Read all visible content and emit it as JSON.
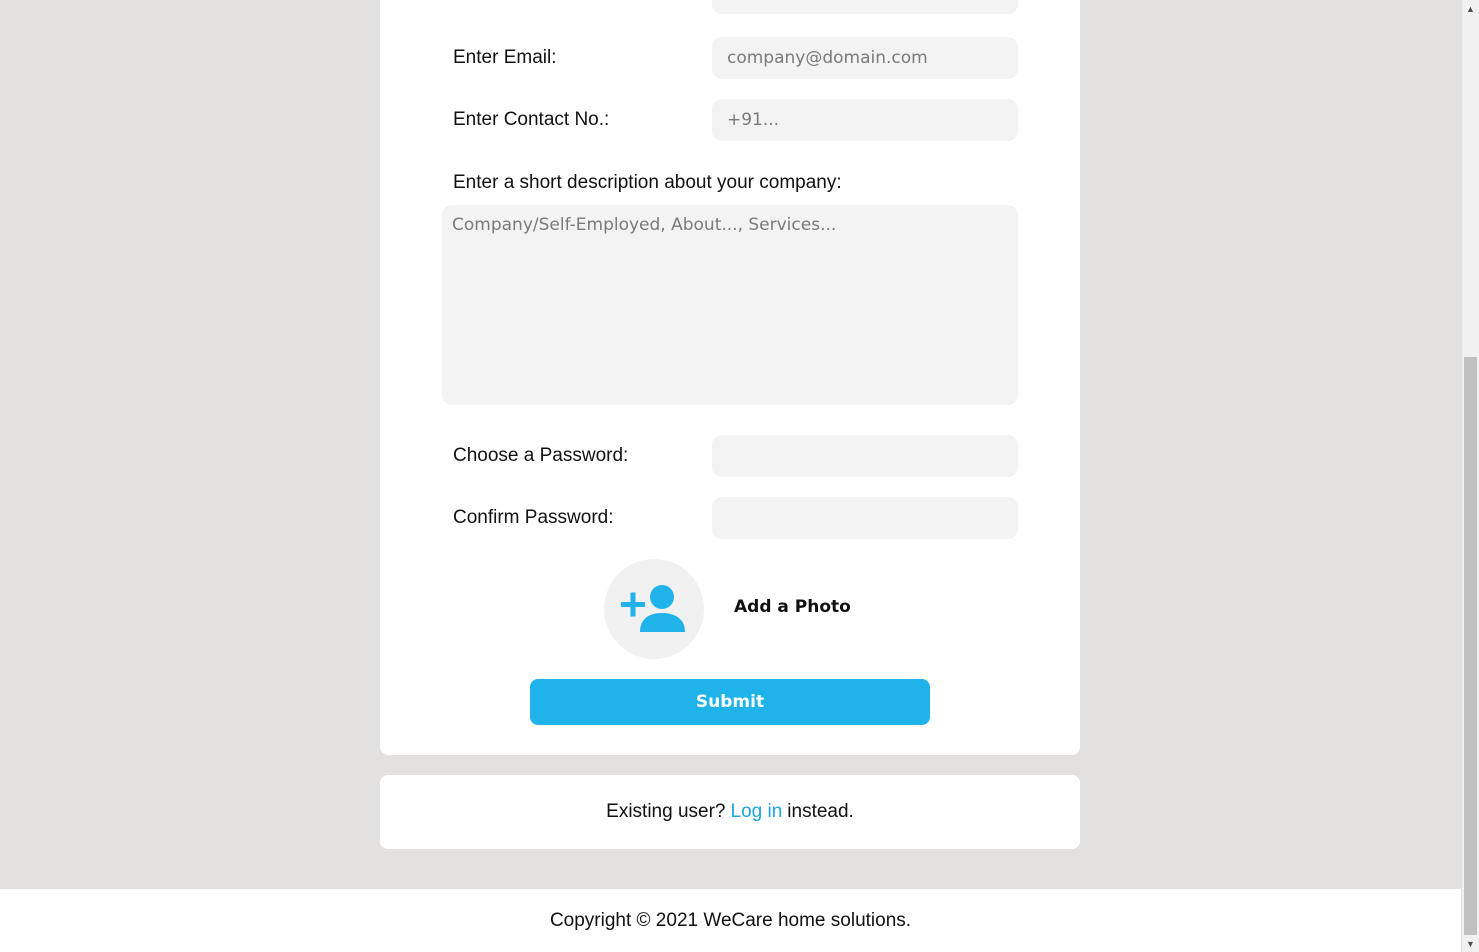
{
  "form": {
    "email_label": "Enter Email:",
    "email_placeholder": "company@domain.com",
    "contact_label": "Enter Contact No.:",
    "contact_placeholder": "+91...",
    "description_label": "Enter a short description about your company:",
    "description_placeholder": "Company/Self-Employed, About..., Services...",
    "password_label": "Choose a Password:",
    "confirm_label": "Confirm Password:",
    "photo_label": "Add a Photo",
    "submit_label": "Submit"
  },
  "login": {
    "prefix": "Existing user?",
    "link": "Log in",
    "suffix": "instead."
  },
  "footer": {
    "copyright": "Copyright © 2021 WeCare home solutions."
  },
  "colors": {
    "accent": "#1fb3ea",
    "page_bg": "#e2e1e0",
    "input_bg": "#f3f3f3"
  }
}
